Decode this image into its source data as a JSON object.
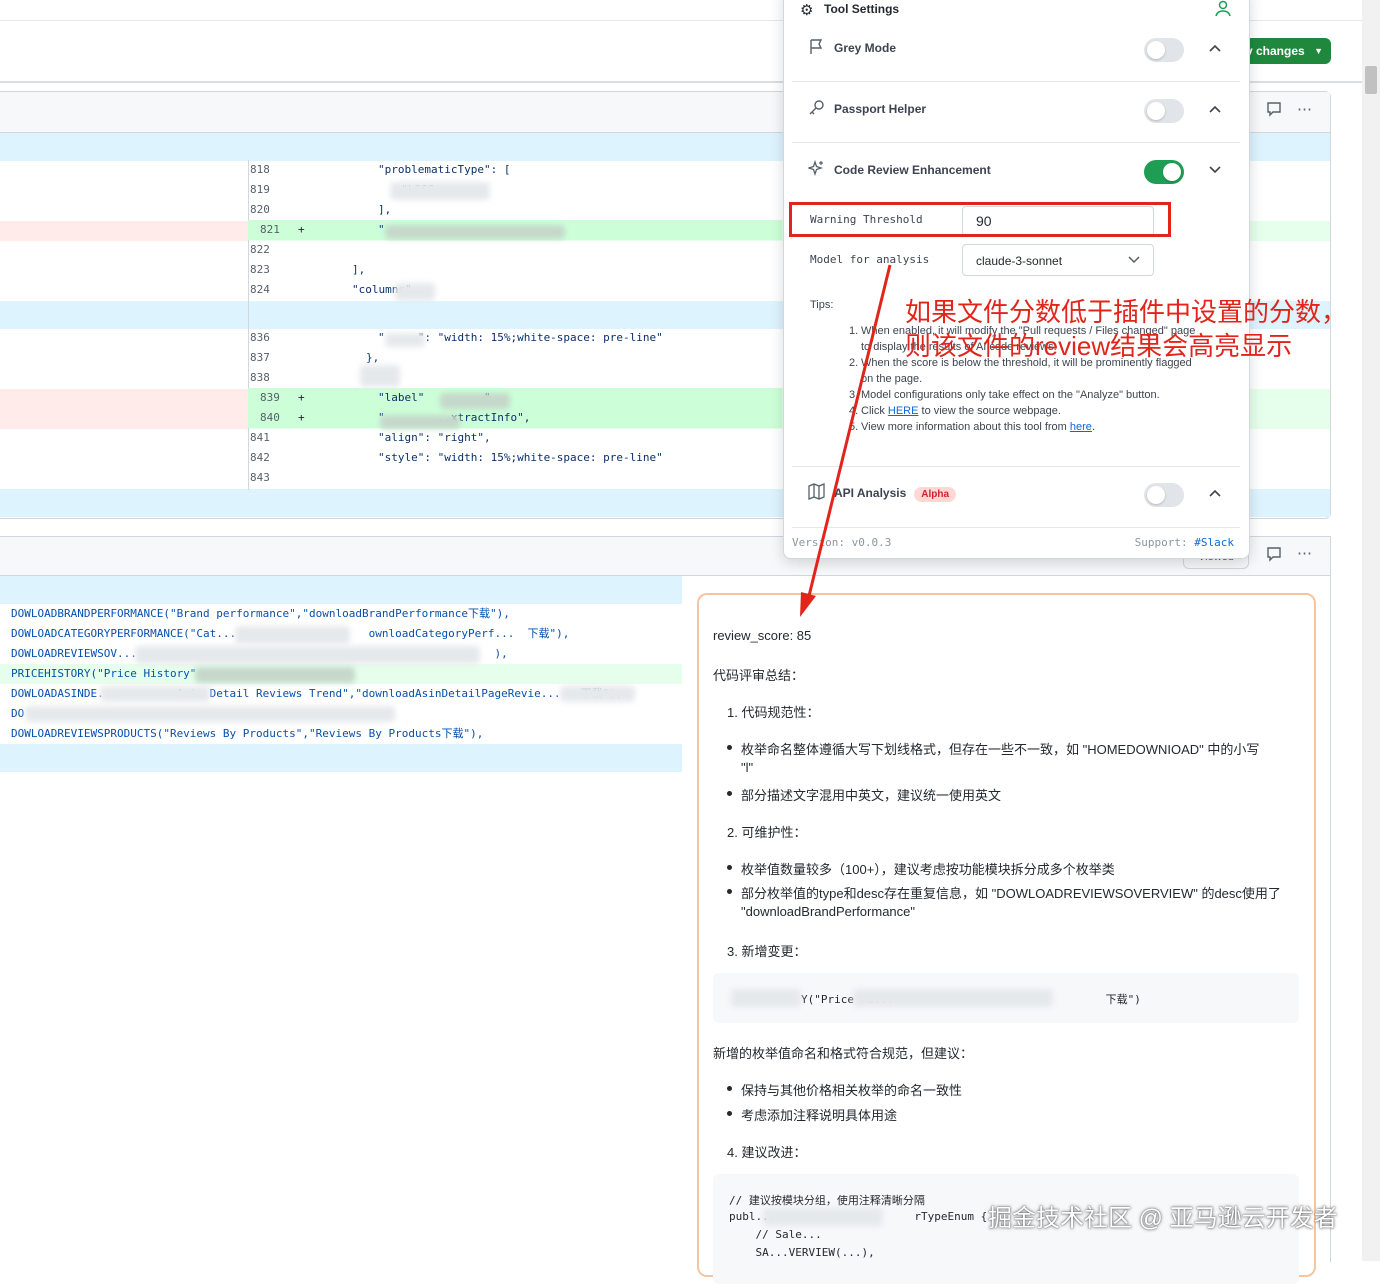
{
  "header": {
    "save_button": "Save changes",
    "save_button_visible": "v changes"
  },
  "diff1": {
    "rows": [
      {
        "num": "818",
        "sign": "",
        "code": "\"problematicType\": [",
        "type": "ctx"
      },
      {
        "num": "819",
        "sign": "",
        "code": "  \"LOSS",
        "type": "ctx"
      },
      {
        "num": "820",
        "sign": "",
        "code": "],",
        "type": "ctx"
      },
      {
        "num": "821",
        "sign": "+",
        "code": "\"",
        "type": "add"
      },
      {
        "num": "822",
        "sign": "",
        "code": "",
        "type": "ctx"
      },
      {
        "num": "823",
        "sign": "",
        "code": "],",
        "type": "ctx"
      },
      {
        "num": "824",
        "sign": "",
        "code": "\"columns\"",
        "type": "ctx"
      },
      {
        "num": "836",
        "sign": "",
        "code": "\"     \": \"width: 15%;white-space: pre-line\"",
        "type": "ctx"
      },
      {
        "num": "837",
        "sign": "",
        "code": "},",
        "type": "ctx"
      },
      {
        "num": "838",
        "sign": "",
        "code": "",
        "type": "ctx"
      },
      {
        "num": "839",
        "sign": "+",
        "code": "\"label\"         \",",
        "type": "add"
      },
      {
        "num": "840",
        "sign": "+",
        "code": "\"       ...xtractInfo\",",
        "type": "add"
      },
      {
        "num": "841",
        "sign": "",
        "code": "\"align\": \"right\",",
        "type": "ctx"
      },
      {
        "num": "842",
        "sign": "",
        "code": "\"style\": \"width: 15%;white-space: pre-line\"",
        "type": "ctx"
      },
      {
        "num": "843",
        "sign": "",
        "code": "",
        "type": "ctx"
      }
    ]
  },
  "diff2": {
    "rows": [
      {
        "code": "DOWLOADBRANDPERFORMANCE(\"Brand performance\",\"downloadBrandPerformance下载\"),",
        "type": "ctx"
      },
      {
        "code": "DOWLOADCATEGORYPERFORMANCE(\"Cat...                    ownloadCategoryPerf...  下载\"),",
        "type": "ctx"
      },
      {
        "code": "DOWLOADREVIEWSOV...                                                      ),",
        "type": "ctx"
      },
      {
        "code": "PRICEHISTORY(\"Price History\"",
        "type": "add"
      },
      {
        "code": "DOWLOADASINDE...         Asin Detail Reviews Trend\",\"downloadAsinDetailPageRevie...   下载\"),",
        "type": "ctx"
      },
      {
        "code": "DO",
        "type": "ctx"
      },
      {
        "code": "DOWLOADREVIEWSPRODUCTS(\"Reviews By Products\",\"Reviews By Products下载\"),",
        "type": "ctx"
      }
    ],
    "viewed_label": "Viewed"
  },
  "review": {
    "score_line": "review_score: 85",
    "summary_heading": "代码评审总结：",
    "s1_title": "1. 代码规范性：",
    "s1_b1": "枚举命名整体遵循大写下划线格式，但存在一些不一致，如 \"HOMEDOWNIOAD\" 中的小写",
    "s1_b1_cont": "\"l\"",
    "s1_b2": "部分描述文字混用中英文，建议统一使用英文",
    "s2_title": "2. 可维护性：",
    "s2_b1": "枚举值数量较多（100+），建议考虑按功能模块拆分成多个枚举类",
    "s2_b2": "部分枚举值的type和desc存在重复信息，如 \"DOWLOADREVIEWSOVERVIEW\" 的desc使用了",
    "s2_b2_cont": "\"downloadBrandPerformance\"",
    "s3_title": "3. 新增变更：",
    "s3_code": "Y(\"Price Hi...                                下载\")",
    "s3_note": "新增的枚举值命名和格式符合规范，但建议：",
    "s3_b1": "保持与其他价格相关枚举的命名一致性",
    "s3_b2": "考虑添加注释说明具体用途",
    "s4_title": "4. 建议改进：",
    "s4_code_l1": "// 建议按模块分组，使用注释清晰分隔",
    "s4_code_l2": "publ...                     rTypeEnum {",
    "s4_code_l3": "    // Sale...",
    "s4_code_l4": "    SA...VERVIEW(...),"
  },
  "panel": {
    "title": "Tool Settings",
    "grey_mode": {
      "label": "Grey Mode",
      "enabled": false
    },
    "passport_helper": {
      "label": "Passport Helper",
      "enabled": false
    },
    "code_review": {
      "label": "Code Review Enhancement",
      "enabled": true
    },
    "warning_threshold_label": "Warning Threshold",
    "warning_threshold_value": "90",
    "model_label": "Model for analysis",
    "model_value": "claude-3-sonnet",
    "tips_label": "Tips:",
    "tips": [
      {
        "n": "1.",
        "text": "When enabled, it will modify the \"Pull requests / Files changed\" page"
      },
      {
        "n": "",
        "text": "to display the results of AI code reviews."
      },
      {
        "n": "2.",
        "text": "When the score is below the threshold, it will be prominently flagged"
      },
      {
        "n": "",
        "text": "on the page."
      },
      {
        "n": "3.",
        "text": "Model configurations only take effect on the \"Analyze\" button."
      }
    ],
    "tip4_pre": "Click ",
    "tip4_link": "HERE",
    "tip4_post": " to view the source webpage.",
    "tip5_pre": "View more information about this tool from ",
    "tip5_link": "here",
    "tip5_post": ".",
    "api_analysis": {
      "label": "API Analysis",
      "badge": "Alpha",
      "enabled": false
    },
    "version": "Version: v0.0.3",
    "support_label": "Support: ",
    "support_link": "#Slack"
  },
  "annotation": {
    "line1": "如果文件分数低于插件中设置的分数，",
    "line2": "则该文件的review结果会高亮显示",
    "color": "#e1251b"
  },
  "watermark": "掘金技术社区 @ 亚马逊云开发者"
}
